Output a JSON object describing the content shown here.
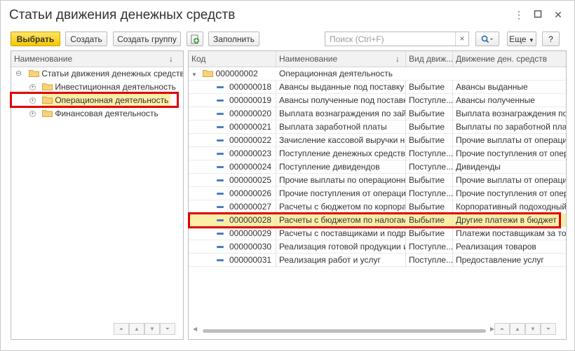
{
  "window": {
    "title": "Статьи движения денежных средств",
    "more_icon": "kebab-icon",
    "restore_icon": "restore-icon",
    "close_icon": "close-icon"
  },
  "toolbar": {
    "select_label": "Выбрать",
    "create_label": "Создать",
    "create_group_label": "Создать группу",
    "fill_label": "Заполнить",
    "search_placeholder": "Поиск (Ctrl+F)",
    "search_clear": "×",
    "more_label": "Еще",
    "help_label": "?"
  },
  "left_tree": {
    "header": "Наименование",
    "sort_icon": "↓",
    "root": "Статьи движения денежных средств",
    "items": [
      {
        "label": "Инвестиционная деятельность"
      },
      {
        "label": "Операционная деятельность"
      },
      {
        "label": "Финансовая деятельность"
      }
    ]
  },
  "table": {
    "headers": {
      "code": "Код",
      "name": "Наименование",
      "sort": "↓",
      "type": "Вид движ...",
      "movement": "Движение ден. средств"
    },
    "group_row": {
      "code": "000000002",
      "name": "Операционная деятельность"
    },
    "rows": [
      {
        "code": "000000018",
        "name": "Авансы выданные под поставку ...",
        "type": "Выбытие",
        "movement": "Авансы выданные"
      },
      {
        "code": "000000019",
        "name": "Авансы полученные под поставк...",
        "type": "Поступле...",
        "movement": "Авансы полученные"
      },
      {
        "code": "000000020",
        "name": "Выплата вознаграждения по зай...",
        "type": "Выбытие",
        "movement": "Выплата вознаграждения по ..."
      },
      {
        "code": "000000021",
        "name": "Выплата заработной платы",
        "type": "Выбытие",
        "movement": "Выплаты по заработной плате"
      },
      {
        "code": "000000022",
        "name": "Зачисление кассовой выручки н...",
        "type": "Выбытие",
        "movement": "Прочие выплаты от операцио..."
      },
      {
        "code": "000000023",
        "name": "Поступление денежных средств ...",
        "type": "Поступле...",
        "movement": "Прочие поступления от опера..."
      },
      {
        "code": "000000024",
        "name": "Поступление дивидендов",
        "type": "Поступле...",
        "movement": "Дивиденды"
      },
      {
        "code": "000000025",
        "name": "Прочие выплаты по операционно...",
        "type": "Выбытие",
        "movement": "Прочие выплаты от операцио..."
      },
      {
        "code": "000000026",
        "name": "Прочие поступления от операцио...",
        "type": "Поступле...",
        "movement": "Прочие поступления от опера..."
      },
      {
        "code": "000000027",
        "name": "Расчеты с бюджетом по корпора...",
        "type": "Выбытие",
        "movement": "Корпоративный подоходный ..."
      },
      {
        "code": "000000028",
        "name": "Расчеты с бюджетом по налогам",
        "type": "Выбытие",
        "movement": "Другие платежи в бюджет"
      },
      {
        "code": "000000029",
        "name": "Расчеты с поставщиками и подр...",
        "type": "Выбытие",
        "movement": "Платежи поставщикам за тов..."
      },
      {
        "code": "000000030",
        "name": "Реализация готовой продукции и...",
        "type": "Поступле...",
        "movement": "Реализация товаров"
      },
      {
        "code": "000000031",
        "name": "Реализация работ и услуг",
        "type": "Поступле...",
        "movement": "Предоставление услуг"
      }
    ]
  },
  "colors": {
    "accent": "#f5c800",
    "selection": "#fbeea8",
    "highlight": "#e00000"
  }
}
